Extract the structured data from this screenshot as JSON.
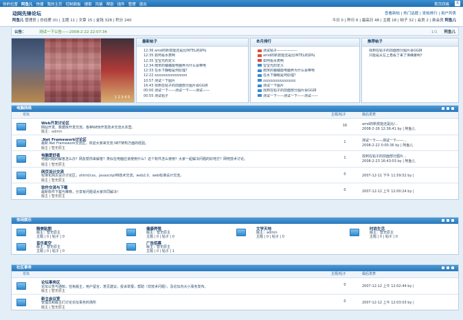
{
  "topbar": {
    "nav": [
      "你的位置",
      "阿鱼儿",
      "快捷",
      "我的主页",
      "控制面板",
      "搜索",
      "风格",
      "帮助",
      "插件",
      "管理",
      "退出"
    ],
    "right_link": "首页四格",
    "close_label": "X"
  },
  "header": {
    "title": "动网先锋论坛",
    "user_name": "阿鱼儿",
    "user_info": "管理员 | 总经理 (0) | 主题 11 | 文章 15 | 金钱 328 | 积分 240",
    "links": "查看新帖 | 热门话题 | 发帖排行 | 用户列表",
    "stats_prefix": "今日 0 | 昨日 6 | 最高日 48 | 主题 18 | 帖子 32 | 会员 2 | 新会员",
    "stats_user": "阿鱼儿"
  },
  "notice": {
    "label": "公告：",
    "message": "测试一下公告——2008-2-22 22:07:34",
    "page": "1/1",
    "right_user": "阿鱼儿"
  },
  "photo": {
    "numbers": "1 2 3 4 5"
  },
  "panels": [
    {
      "title": "最新帖子",
      "items": [
        "12:36 amd的新技能还是比INTEL的好吗",
        "12:35 如何看水表啊",
        "12:35 宝宝光的定义",
        "12:34 南宋的蛐蛐能电脑养为什么会带电",
        "12:33 在水下静眼是何原理？",
        "12:22 zzzzzzzzzzzzzzzzzz",
        "10:57 测试一下图片",
        "16:43 找到在帖子的前面部分图片会GG拼",
        "00:00 测试一下——测试一下——测试——",
        "00:55 测试帖子"
      ]
    },
    {
      "title": "本月排行",
      "items": [
        "测试帖子——————",
        "amd的新技能还是比INTEL的好吗",
        "如何看水表啊",
        "宝宝光的定义",
        "南宋的蛐蛐能电脑养为什么会带电",
        "在水下静眼是何原理？",
        "zzzzzzzzzzzzzzzzzz",
        "测试一下图片",
        "找到在帖子的前面部分图片会GG拼",
        "测试一下——测试一下——测试——"
      ]
    },
    {
      "title": "推荐帖子",
      "items": [
        "找到在帖子的前面部分图片会GG拼",
        "只能是从左上角看了来了准确量明？"
      ]
    }
  ],
  "sections": [
    {
      "title": "电脑网络",
      "cols": {
        "forum": "论坛",
        "count": "主题/帖子",
        "last": "最后发表"
      },
      "rows": [
        {
          "name": "Web开发讨论区",
          "desc": "网站开发、数据库开发交流，各种WEB开发技术交流大本营。",
          "mod": "版主：admin",
          "count": "16",
          "last1": "amd的新技能还是比/...",
          "last2": "2008-2-26 12:36:41 by | 阿鱼儿"
        },
        {
          "name": ".Net Framework讨论区",
          "desc": "最新.Net Framework交流区，欢迎大家来交流.NET架构方面的经验。",
          "mod": "版主 | 智无原主",
          "count": "1",
          "last1": "测试一下——测试一下——...",
          "last2": "2008-2-22 0:00:36 by | 阿鱼儿"
        },
        {
          "name": "电脑爱好者",
          "desc": "电脑问题的解答怎么办？网友帮你来解答？类似在电脑应该使用什么？这个软件怎么使用？大家一起解决问题的好地方？网吧技术讨论。",
          "mod": "版主 | 智无原主",
          "count": "1",
          "last1": "找到在帖子的前面部分图片...",
          "last2": "2008-2-23 16:43:03 by | 阿鱼儿"
        },
        {
          "name": "网页设计交流",
          "desc": "标准化网页设计讨论区，xhtml/css、javascript特技术交流，web2.0、web标准设计交流。",
          "mod": "版主 | 智无原主",
          "count": "0",
          "last1": "",
          "last2": "2007-12-11 下午 11:59:52 by |"
        },
        {
          "name": "软件交流与下载",
          "desc": "最新软件下载与推荐，分享有问题请大家共同解决！",
          "mod": "版主 | 智无原主",
          "count": "0",
          "last1": "",
          "last2": "2007-12-12 上午 12:00:24 by |"
        }
      ]
    },
    {
      "title": "休闲娱乐",
      "cells": [
        {
          "name": "精美贴图",
          "l2": "版主：智无原主",
          "l3": "主题 | 0 | 帖子 | 0"
        },
        {
          "name": "健康养殖",
          "l2": "版主：智无原主",
          "l3": "主题 | 0 | 帖子 | 0"
        },
        {
          "name": "文学天地",
          "l2": "版主：admin",
          "l3": "主题 | 0 | 帖子 | 0"
        },
        {
          "name": "时尚生活",
          "l2": "版主：智无原主",
          "l3": "主题 | 0 | 帖子 | 0"
        },
        {
          "name": "音乐星空",
          "l2": "版主：智无原主",
          "l3": "主题 | 0 | 帖子 | 0"
        },
        {
          "name": "广告招募",
          "l2": "版主：智无原主",
          "l3": "主题 | 0 | 帖子 | 1"
        }
      ]
    },
    {
      "title": "社区事务",
      "cols": {
        "forum": "论坛",
        "count": "主题/帖子",
        "last": "最后发表"
      },
      "rows": [
        {
          "name": "论坛事务区",
          "desc": "论坛公告与通知，任免版主，用户留言，意见建议，投诉举报，帮助（非技术问题），及论坛内大小事务发布。",
          "mod": "版主 | 智无原主",
          "count": "0",
          "last1": "",
          "last2": "2007-12-12 上午 12:02:44 by |"
        },
        {
          "name": "新主会议室",
          "desc": "管理员和版主们讨论论坛事务的场所",
          "mod": "版主 | 智无原主",
          "count": "0",
          "last1": "",
          "last2": "2007-12-12 上午 12:03:03 by |"
        }
      ]
    }
  ],
  "colors": {
    "bar": "#2a78bb",
    "bg": "#e4eef7",
    "border": "#b7cde3"
  }
}
